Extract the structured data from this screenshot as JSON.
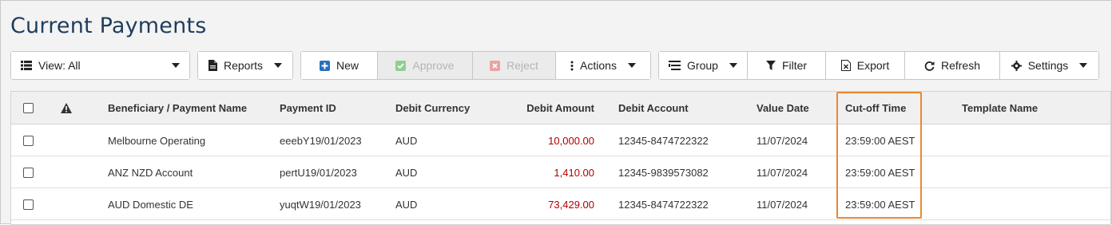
{
  "page": {
    "title": "Current Payments"
  },
  "toolbar": {
    "view_label": "View: All",
    "reports_label": "Reports",
    "new_label": "New",
    "approve_label": "Approve",
    "reject_label": "Reject",
    "actions_label": "Actions",
    "group_label": "Group",
    "filter_label": "Filter",
    "export_label": "Export",
    "refresh_label": "Refresh",
    "settings_label": "Settings"
  },
  "table": {
    "columns": {
      "warning_icon": "warning-icon",
      "name": "Beneficiary / Payment Name",
      "payment_id": "Payment ID",
      "debit_currency": "Debit Currency",
      "debit_amount": "Debit Amount",
      "debit_account": "Debit Account",
      "value_date": "Value Date",
      "cutoff_time": "Cut-off Time",
      "template_name": "Template Name"
    },
    "rows": [
      {
        "name": "Melbourne Operating",
        "payment_id": "eeebY19/01/2023",
        "debit_currency": "AUD",
        "debit_amount": "10,000.00",
        "debit_account": "12345-8474722322",
        "value_date": "11/07/2024",
        "cutoff_time": "23:59:00 AEST",
        "template_name": ""
      },
      {
        "name": "ANZ NZD Account",
        "payment_id": "pertU19/01/2023",
        "debit_currency": "AUD",
        "debit_amount": "1,410.00",
        "debit_account": "12345-9839573082",
        "value_date": "11/07/2024",
        "cutoff_time": "23:59:00 AEST",
        "template_name": ""
      },
      {
        "name": "AUD Domestic DE",
        "payment_id": "yuqtW19/01/2023",
        "debit_currency": "AUD",
        "debit_amount": "73,429.00",
        "debit_account": "12345-8474722322",
        "value_date": "11/07/2024",
        "cutoff_time": "23:59:00 AEST",
        "template_name": ""
      }
    ]
  },
  "colors": {
    "title": "#1f3d5c",
    "amount": "#b00000",
    "highlight": "#e8892f",
    "new_icon": "#2a6ebb",
    "approve_icon": "#8fcf8f",
    "reject_icon": "#e7a3a3"
  }
}
